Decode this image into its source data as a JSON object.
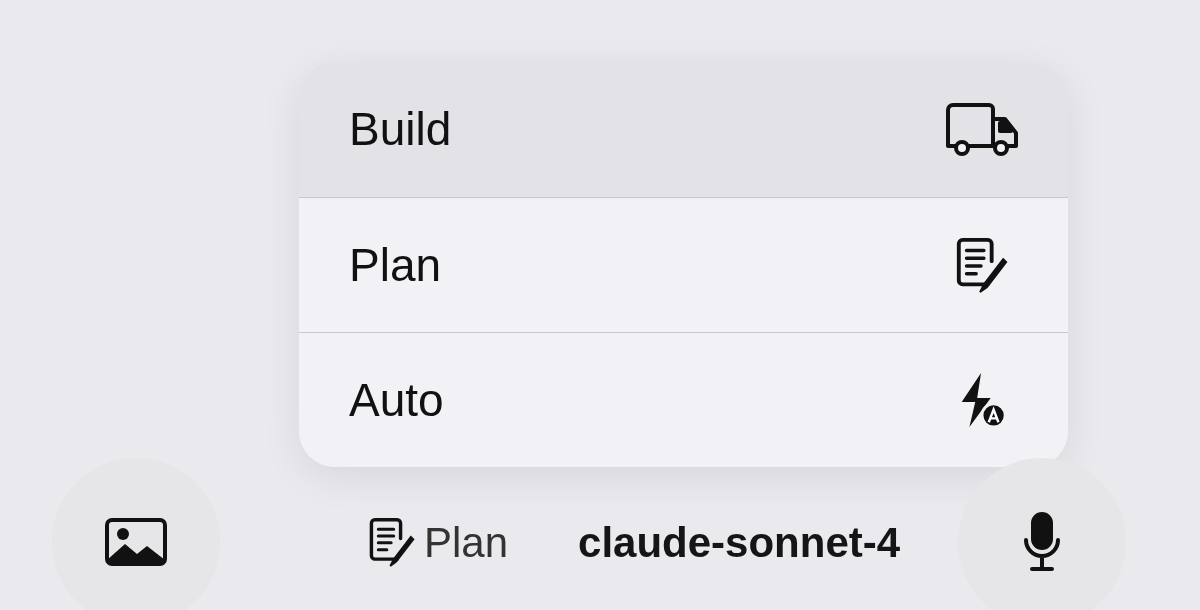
{
  "menu": {
    "items": [
      {
        "label": "Build",
        "kind": "truck",
        "selected": true
      },
      {
        "label": "Plan",
        "kind": "document",
        "selected": false
      },
      {
        "label": "Auto",
        "kind": "auto",
        "selected": false
      }
    ]
  },
  "toolbar": {
    "mode": {
      "label": "Plan",
      "kind": "document"
    },
    "model": "claude-sonnet-4"
  }
}
